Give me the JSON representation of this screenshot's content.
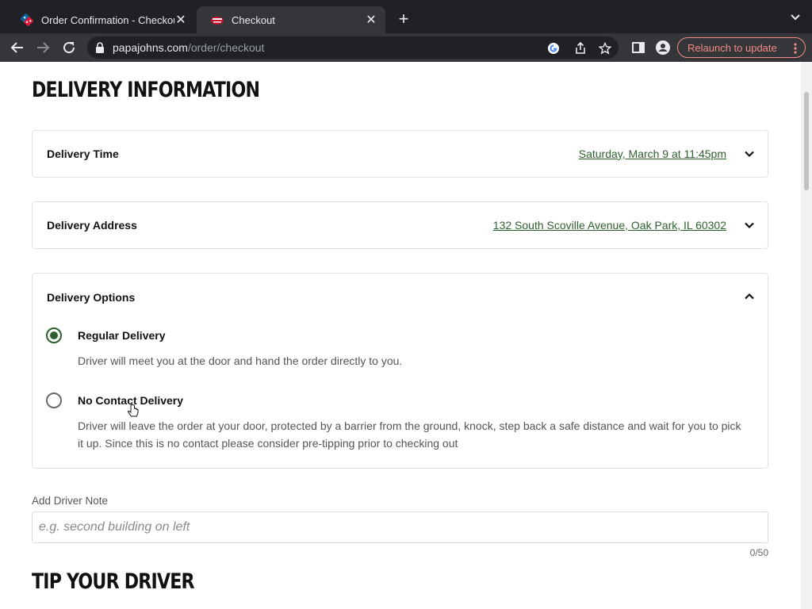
{
  "browser": {
    "tabs": [
      {
        "title": "Order Confirmation - Checkout",
        "active": false,
        "favicon": "dominos-icon"
      },
      {
        "title": "Checkout",
        "active": true,
        "favicon": "papajohns-icon"
      }
    ],
    "url_host": "papajohns.com",
    "url_path": "/order/checkout",
    "relaunch_label": "Relaunch to update"
  },
  "delivery": {
    "heading": "DELIVERY INFORMATION",
    "time_label": "Delivery Time",
    "time_value": "Saturday, March 9 at 11:45pm",
    "address_label": "Delivery Address",
    "address_value": "132 South Scoville Avenue, Oak Park, IL 60302",
    "options_label": "Delivery Options",
    "options": [
      {
        "title": "Regular Delivery",
        "desc": "Driver will meet you at the door and hand the order directly to you.",
        "selected": true
      },
      {
        "title": "No Contact Delivery",
        "desc": "Driver will leave the order at your door, protected by a barrier from the ground, knock, step back a safe distance and wait for you to pick it up. Since this is no contact please consider pre-tipping prior to checking out",
        "selected": false
      }
    ]
  },
  "note": {
    "label": "Add Driver Note",
    "placeholder": "e.g. second building on left",
    "value": "",
    "counter": "0/50"
  },
  "tip": {
    "heading": "TIP YOUR DRIVER"
  },
  "colors": {
    "accent_green": "#2d5f2e",
    "chrome_dark": "#202124",
    "chrome_toolbar": "#35363a",
    "relaunch_red": "#f28b82"
  }
}
